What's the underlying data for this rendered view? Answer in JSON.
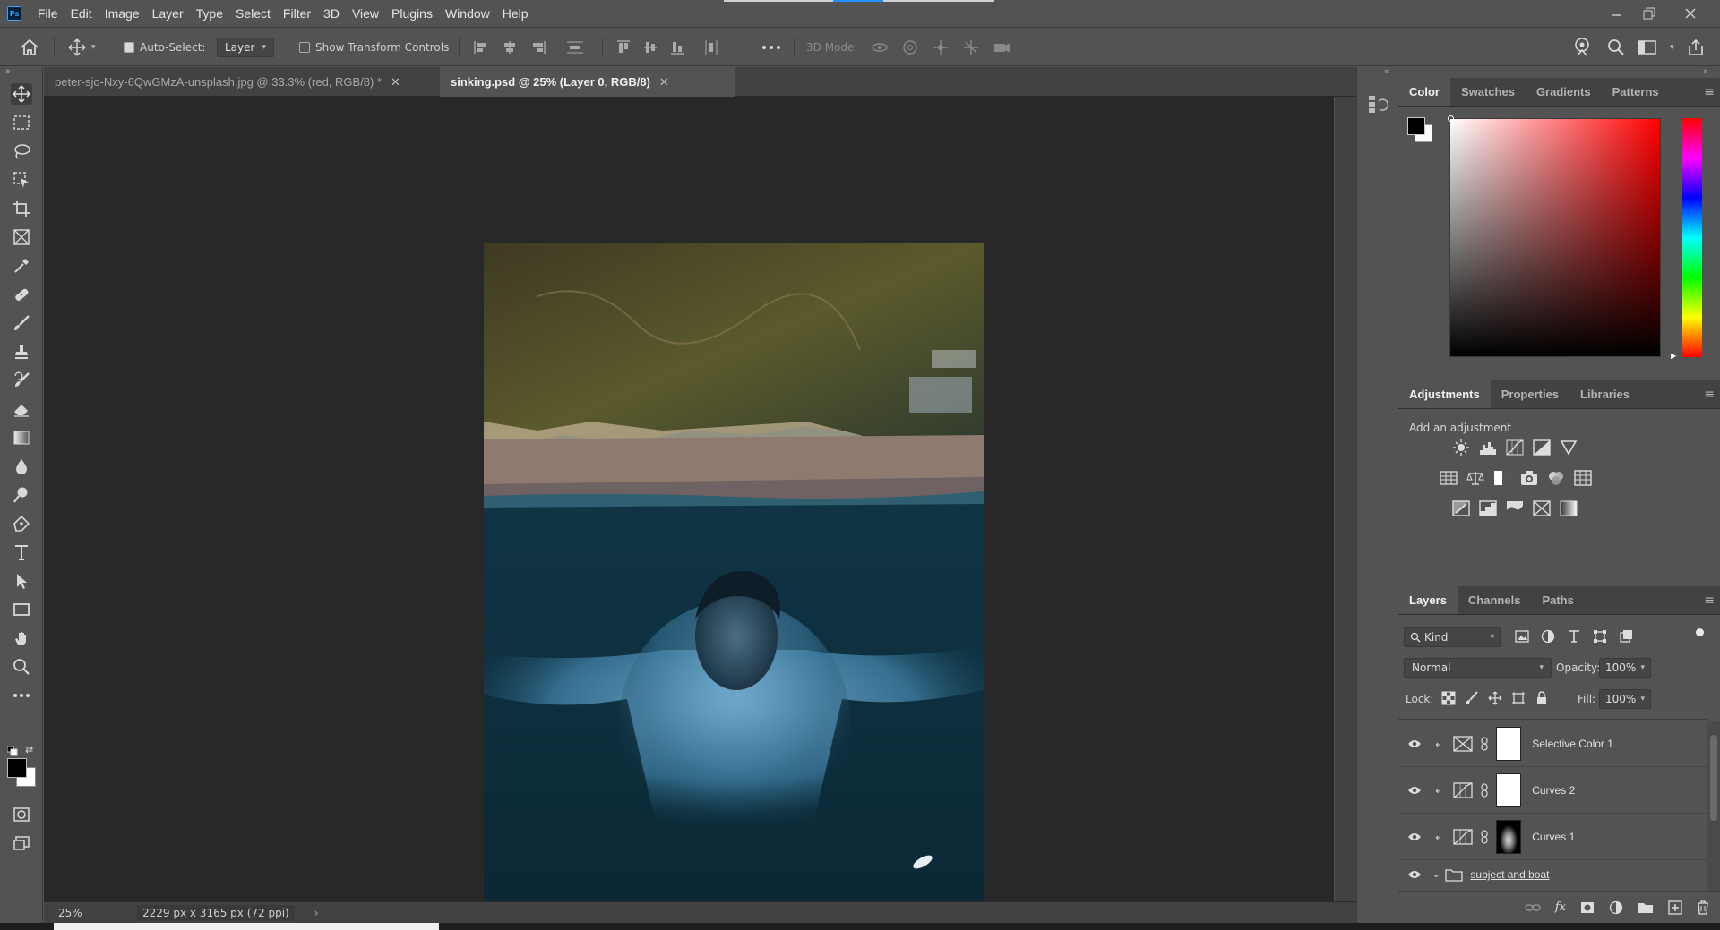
{
  "menubar": {
    "logo": "Ps",
    "items": [
      "File",
      "Edit",
      "Image",
      "Layer",
      "Type",
      "Select",
      "Filter",
      "3D",
      "View",
      "Plugins",
      "Window",
      "Help"
    ]
  },
  "options": {
    "auto_select_label": "Auto-Select:",
    "auto_select_target": "Layer",
    "show_transform_label": "Show Transform Controls",
    "mode_3d_label": "3D Mode:"
  },
  "tabs": [
    {
      "label": "peter-sjo-Nxy-6QwGMzA-unsplash.jpg @ 33.3% (red, RGB/8) *"
    },
    {
      "label": "sinking.psd @ 25% (Layer 0, RGB/8)"
    }
  ],
  "status": {
    "zoom": "25%",
    "doc_info": "2229 px x 3165 px (72 ppi)"
  },
  "color_panel": {
    "tabs": [
      "Color",
      "Swatches",
      "Gradients",
      "Patterns"
    ],
    "active_tab": "Color",
    "foreground": "#000000",
    "background": "#ffffff",
    "hue_color": "#ff0000"
  },
  "adjustments_panel": {
    "tabs": [
      "Adjustments",
      "Properties",
      "Libraries"
    ],
    "heading": "Add an adjustment"
  },
  "layers_panel": {
    "tabs": [
      "Layers",
      "Channels",
      "Paths"
    ],
    "kind_label": "Kind",
    "blend_mode": "Normal",
    "opacity_label": "Opacity:",
    "opacity_value": "100%",
    "lock_label": "Lock:",
    "fill_label": "Fill:",
    "fill_value": "100%",
    "layers": [
      {
        "name": "Selective Color 1",
        "type": "selective-color"
      },
      {
        "name": "Curves 2",
        "type": "curves"
      },
      {
        "name": "Curves 1",
        "type": "curves"
      },
      {
        "name": "subject and boat",
        "type": "group"
      }
    ]
  }
}
